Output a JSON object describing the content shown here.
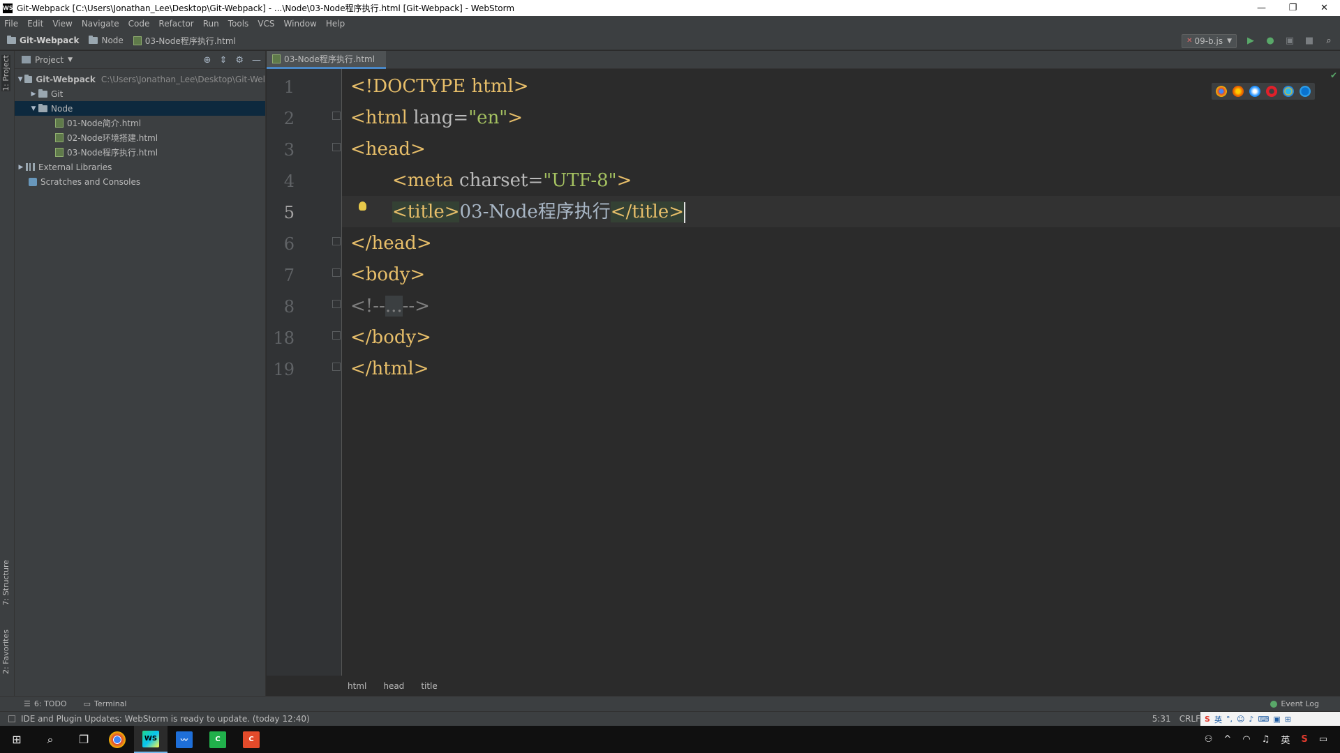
{
  "window": {
    "title": "Git-Webpack [C:\\Users\\Jonathan_Lee\\Desktop\\Git-Webpack] - ...\\Node\\03-Node程序执行.html [Git-Webpack] - WebStorm",
    "app_icon": "WS",
    "minimize": "—",
    "maximize": "❐",
    "close": "✕"
  },
  "menu": [
    "File",
    "Edit",
    "View",
    "Navigate",
    "Code",
    "Refactor",
    "Run",
    "Tools",
    "VCS",
    "Window",
    "Help"
  ],
  "navbar": {
    "project": "Git-Webpack",
    "folder": "Node",
    "file": "03-Node程序执行.html",
    "run_config": "09-b.js"
  },
  "side_tabs": {
    "project": "1: Project",
    "structure": "7: Structure",
    "favorites": "2: Favorites"
  },
  "project_panel": {
    "title": "Project",
    "tree": [
      {
        "label": "Git-Webpack",
        "path": "C:\\Users\\Jonathan_Lee\\Desktop\\Git-Wel",
        "depth": 0,
        "arrow": "▼",
        "kind": "folder"
      },
      {
        "label": "Git",
        "depth": 1,
        "arrow": "▶",
        "kind": "folder"
      },
      {
        "label": "Node",
        "depth": 1,
        "arrow": "▼",
        "kind": "folder",
        "selected": true
      },
      {
        "label": "01-Node简介.html",
        "depth": 2,
        "kind": "html"
      },
      {
        "label": "02-Node环境搭建.html",
        "depth": 2,
        "kind": "html"
      },
      {
        "label": "03-Node程序执行.html",
        "depth": 2,
        "kind": "html"
      },
      {
        "label": "External Libraries",
        "depth": 0,
        "arrow": "▶",
        "kind": "lib"
      },
      {
        "label": "Scratches and Consoles",
        "depth": 0,
        "kind": "scratch"
      }
    ]
  },
  "editor": {
    "tab": "03-Node程序执行.html",
    "line_numbers": [
      "1",
      "2",
      "3",
      "4",
      "5",
      "6",
      "7",
      "8",
      "18",
      "19"
    ],
    "code": {
      "l1": "<!DOCTYPE html>",
      "l2_open": "<html ",
      "l2_attr": "lang=",
      "l2_val": "\"en\"",
      "l2_close": ">",
      "l3": "<head>",
      "l4_open": "<meta ",
      "l4_attr": "charset=",
      "l4_val": "\"UTF-8\"",
      "l4_close": ">",
      "l5_open": "<title>",
      "l5_text": "03-Node程序执行",
      "l5_close": "</title>",
      "l6": "</head>",
      "l7": "<body>",
      "l8_start": "<!--",
      "l8_dots": "...",
      "l8_end": "-->",
      "l18": "</body>",
      "l19": "</html>"
    },
    "breadcrumbs": [
      "html",
      "head",
      "title"
    ],
    "browser_icons": [
      "chrome-icon",
      "firefox-icon",
      "safari-icon",
      "opera-icon",
      "ie-icon",
      "edge-icon"
    ]
  },
  "bottom_tabs": {
    "todo": "6: TODO",
    "terminal": "Terminal",
    "event_log": "Event Log"
  },
  "status": {
    "message": "IDE and Plugin Updates: WebStorm is ready to update. (today 12:40)",
    "position": "5:31",
    "line_sep": "CRLF",
    "ime_lang": "英"
  },
  "colors": {
    "tag": "#e8bf6a",
    "attr": "#bababa",
    "string": "#a5c261",
    "text": "#a9b7c6",
    "selection": "#0d293e",
    "accent": "#4a88c7"
  }
}
